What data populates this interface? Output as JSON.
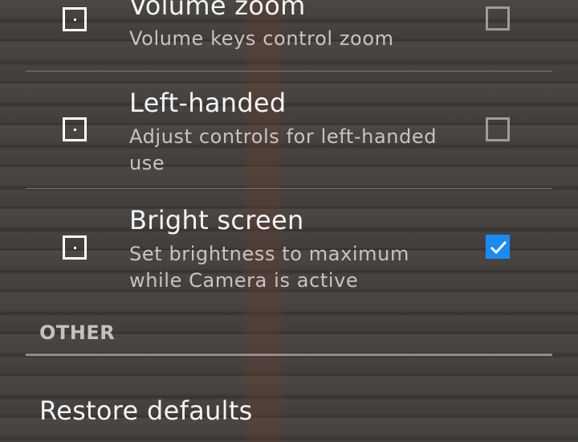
{
  "preferences": [
    {
      "title": "Volume zoom",
      "summary": "Volume keys control zoom",
      "checked": false,
      "icon": "settings-dot-icon"
    },
    {
      "title": "Left-handed",
      "summary": "Adjust controls for left-handed use",
      "checked": false,
      "icon": "settings-dot-icon"
    },
    {
      "title": "Bright screen",
      "summary": "Set brightness to maximum while Camera is active",
      "checked": true,
      "icon": "settings-dot-icon"
    }
  ],
  "category": {
    "label": "OTHER"
  },
  "actions": {
    "restore_label": "Restore defaults"
  },
  "colors": {
    "accent": "#1a8bf2",
    "text_primary": "#f4f4f4",
    "text_secondary": "#c7c4c1"
  }
}
